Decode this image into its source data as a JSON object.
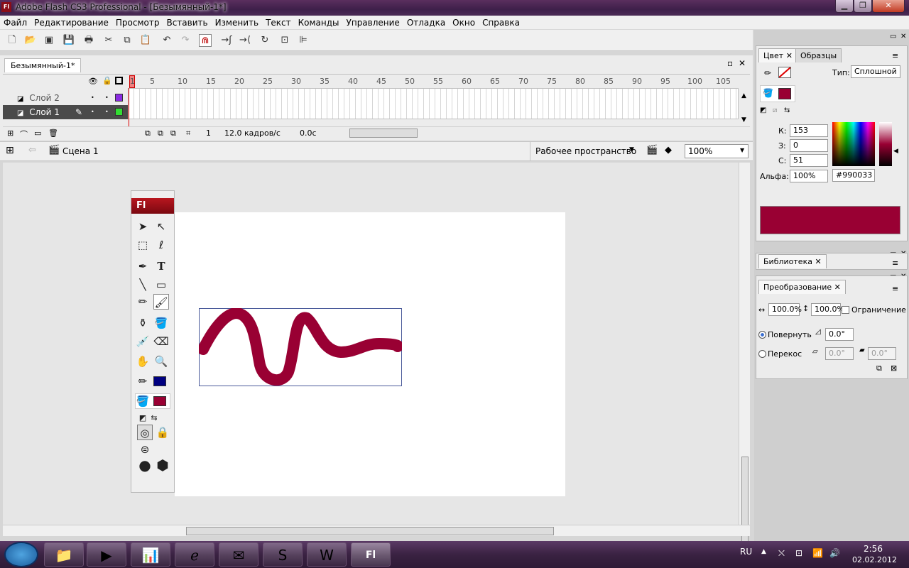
{
  "window": {
    "title": "Adobe Flash CS3 Professional - [Безымянный-1*]",
    "app_icon": "Fl"
  },
  "menu": [
    "Файл",
    "Редактирование",
    "Просмотр",
    "Вставить",
    "Изменить",
    "Текст",
    "Команды",
    "Управление",
    "Отладка",
    "Окно",
    "Справка"
  ],
  "timeline": {
    "doc_tab": "Безымянный-1*",
    "ruler": [
      "1",
      "5",
      "10",
      "15",
      "20",
      "25",
      "30",
      "35",
      "40",
      "45",
      "50",
      "55",
      "60",
      "65",
      "70",
      "75",
      "80",
      "85",
      "90",
      "95",
      "100",
      "105"
    ],
    "layers": [
      {
        "name": "Слой 2",
        "color": "#8a2be2",
        "selected": false
      },
      {
        "name": "Слой 1",
        "color": "#33dd33",
        "selected": true
      }
    ],
    "current_frame": "1",
    "fps": "12.0 кадров/с",
    "time": "0.0с"
  },
  "scene": {
    "name": "Сцена 1",
    "workspace": "Рабочее пространство",
    "zoom": "100%"
  },
  "tools": {
    "title": "Fl",
    "stroke_color": "#000080",
    "fill_color": "#990033"
  },
  "color_panel": {
    "tabs": [
      "Цвет",
      "Образцы"
    ],
    "type_label": "Тип:",
    "type_value": "Сплошной",
    "r_label": "К:",
    "r": "153",
    "g_label": "З:",
    "g": "0",
    "b_label": "С:",
    "b": "51",
    "alpha_label": "Альфа:",
    "alpha": "100%",
    "hex": "#990033",
    "preview": "#990033"
  },
  "library": {
    "tab": "Библиотека"
  },
  "transform": {
    "tab": "Преобразование",
    "width": "100.0%",
    "height": "100.0%",
    "constrain": "Ограничение",
    "rotate_label": "Повернуть",
    "rotate": "0.0°",
    "skew_label": "Перекос",
    "skew_h": "0.0°",
    "skew_v": "0.0°"
  },
  "taskbar": {
    "lang": "RU",
    "time": "2:56",
    "date": "02.02.2012"
  }
}
